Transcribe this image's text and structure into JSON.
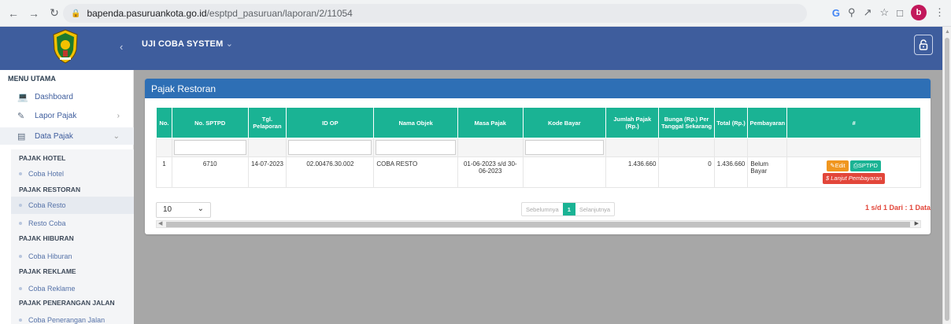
{
  "browser": {
    "url_host": "bapenda.pasuruankota.go.id",
    "url_path": "/esptpd_pasuruan/laporan/2/11054",
    "profile_initial": "b"
  },
  "header": {
    "app_name": "UJI COBA SYSTEM",
    "color": "#3e5d9d"
  },
  "sidebar": {
    "menu_title": "MENU UTAMA",
    "items": [
      {
        "label": "Dashboard",
        "icon": "monitor-icon"
      },
      {
        "label": "Lapor Pajak",
        "icon": "pencil-icon"
      },
      {
        "label": "Data Pajak",
        "icon": "table-icon"
      }
    ],
    "groups": [
      {
        "heading": "PAJAK HOTEL",
        "items": [
          "Coba Hotel"
        ]
      },
      {
        "heading": "PAJAK RESTORAN",
        "items": [
          "Coba Resto",
          "Resto Coba"
        ]
      },
      {
        "heading": "PAJAK HIBURAN",
        "items": [
          "Coba Hiburan"
        ]
      },
      {
        "heading": "PAJAK REKLAME",
        "items": [
          "Coba Reklame"
        ]
      },
      {
        "heading": "PAJAK PENERANGAN JALAN",
        "items": [
          "Coba Penerangan Jalan"
        ]
      }
    ]
  },
  "panel": {
    "title": "Pajak Restoran",
    "columns": [
      "No.",
      "No. SPTPD",
      "Tgl. Pelaporan",
      "ID OP",
      "Nama Objek",
      "Masa Pajak",
      "Kode Bayar",
      "Jumlah Pajak (Rp.)",
      "Bunga (Rp.) Per Tanggal Sekarang",
      "Total (Rp.)",
      "Pembayaran",
      "#"
    ],
    "rows": [
      {
        "no": "1",
        "sptpd": "6710",
        "tgl": "14-07-2023",
        "id_op": "02.00476.30.002",
        "nama": "COBA RESTO",
        "masa": "01-06-2023 s/d 30-06-2023",
        "kode": "",
        "jumlah": "1.436.660",
        "bunga": "0",
        "total": "1.436.660",
        "pembayaran": "Belum Bayar"
      }
    ],
    "actions": {
      "edit": "Edit",
      "sptpd": "SPTPD",
      "pay": "$ Lanjut Pembayaran"
    },
    "page_length": "10",
    "pager": {
      "prev": "Sebelumnya",
      "current": "1",
      "next": "Selanjutnya"
    },
    "info": "1 s/d 1 Dari : 1 Data"
  },
  "colors": {
    "accent": "#1ab394",
    "header": "#2e6fb5",
    "danger": "#e2463a",
    "warning": "#f0961f"
  }
}
